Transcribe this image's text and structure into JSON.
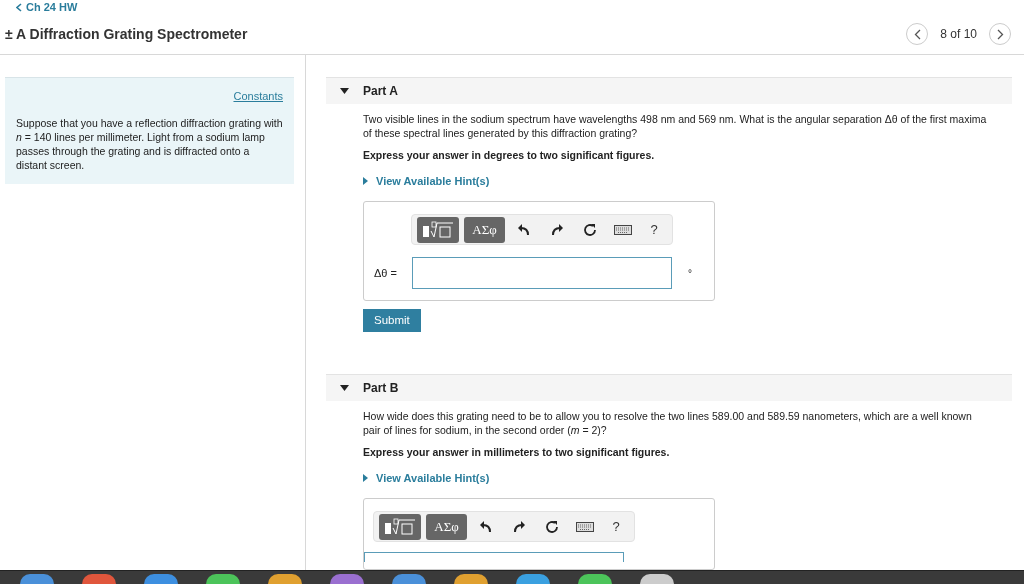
{
  "back_link": "Ch 24 HW",
  "title": "± A Diffraction Grating Spectrometer",
  "pager": {
    "text": "8 of 10"
  },
  "sidebar": {
    "link": "Constants",
    "text": "Suppose that you have a reflection diffraction grating with *n* = 140 lines per millimeter. Light from a sodium lamp passes through the grating and is diffracted onto a distant screen."
  },
  "parts": [
    {
      "label": "Part A",
      "expanded": true,
      "question": "Two visible lines in the sodium spectrum have wavelengths 498 nm and 569 nm. What is the angular separation Δθ of the first maxima of these spectral lines generated by this diffraction grating?",
      "instruction": "Express your answer in degrees to two significant figures.",
      "hint": "View Available Hint(s)",
      "greek": "ΑΣφ",
      "help": "?",
      "answer_label": "Δθ =",
      "unit": "°",
      "submit": "Submit"
    },
    {
      "label": "Part B",
      "expanded": true,
      "question": "How wide does this grating need to be to allow you to resolve the two lines 589.00 and 589.59 nanometers, which are a well known pair of lines for sodium, in the second order (*m* = 2)?",
      "instruction": "Express your answer in millimeters to two significant figures.",
      "hint": "View Available Hint(s)",
      "greek": "ΑΣφ",
      "help": "?"
    }
  ]
}
